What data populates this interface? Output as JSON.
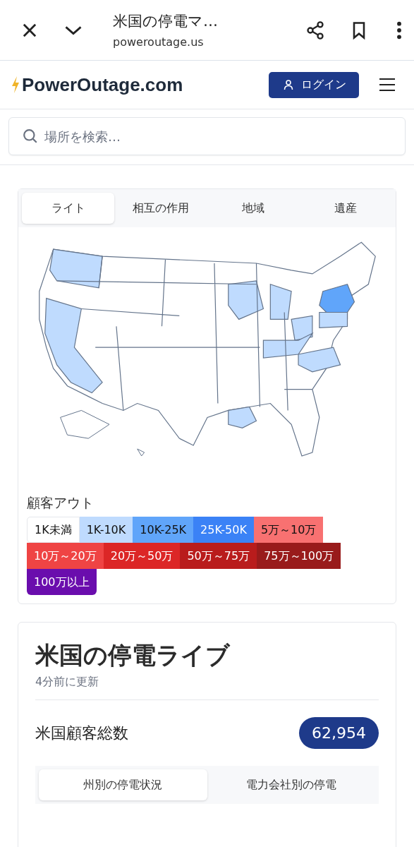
{
  "browser_bar": {
    "title": "米国の停電マ…",
    "url": "poweroutage.us"
  },
  "site_header": {
    "logo": "PowerOutage.com",
    "login_button": "ログイン"
  },
  "search": {
    "placeholder": "場所を検索…"
  },
  "map_card": {
    "tabs": [
      {
        "label": "ライト",
        "selected": true
      },
      {
        "label": "相互の作用",
        "selected": false
      },
      {
        "label": "地域",
        "selected": false
      },
      {
        "label": "遺産",
        "selected": false
      }
    ],
    "legend_title": "顧客アウト",
    "legend": [
      {
        "label": "1K未満",
        "color": "#ffffff"
      },
      {
        "label": "1K-10K",
        "color": "#bfdbfe"
      },
      {
        "label": "10K-25K",
        "color": "#60a5fa"
      },
      {
        "label": "25K-50K",
        "color": "#3b82f6"
      },
      {
        "label": "5万～10万",
        "color": "#f87171"
      },
      {
        "label": "10万～20万",
        "color": "#ef4444"
      },
      {
        "label": "20万～50万",
        "color": "#dc2626"
      },
      {
        "label": "50万～75万",
        "color": "#b91c1c"
      },
      {
        "label": "75万～100万",
        "color": "#991b1b"
      },
      {
        "label": "100万以上",
        "color": "#6a0dad"
      }
    ]
  },
  "live_card": {
    "title": "米国の停電ライブ",
    "updated": "4分前に更新",
    "total_label": "米国顧客総数",
    "total_value": "62,954",
    "tabs": [
      {
        "label": "州別の停電状況",
        "selected": true
      },
      {
        "label": "電力会社別の停電",
        "selected": false
      }
    ]
  }
}
